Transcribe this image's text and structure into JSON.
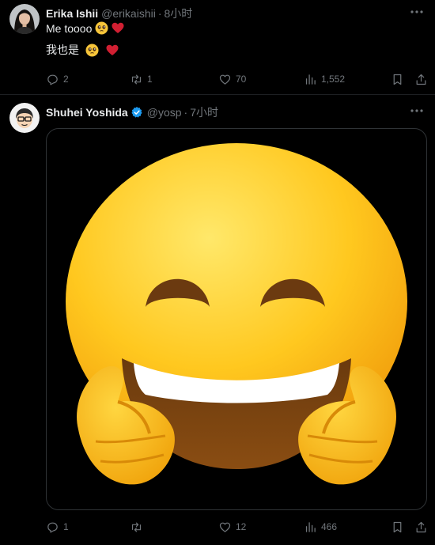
{
  "tweets": [
    {
      "name": "Erika Ishii",
      "handle": "@erikaishii",
      "dot": "·",
      "time": "8小时",
      "lines": [
        "Me toooo",
        "我也是"
      ],
      "actions": {
        "replies": "2",
        "retweets": "1",
        "likes": "70",
        "views": "1,552"
      }
    },
    {
      "name": "Shuhei Yoshida",
      "handle": "@yosp",
      "dot": "·",
      "time": "7小时",
      "verified": true,
      "media": {
        "icon": "thumbs-up-smiling-face-emoji"
      },
      "actions": {
        "replies": "1",
        "retweets": "",
        "likes": "12",
        "views": "466"
      }
    }
  ],
  "colors": {
    "background": "#000000",
    "text": "#e7e9ea",
    "muted": "#71767b",
    "verified": "#1d9bf0",
    "heart": "#d11f32",
    "border": "#2f3336"
  }
}
